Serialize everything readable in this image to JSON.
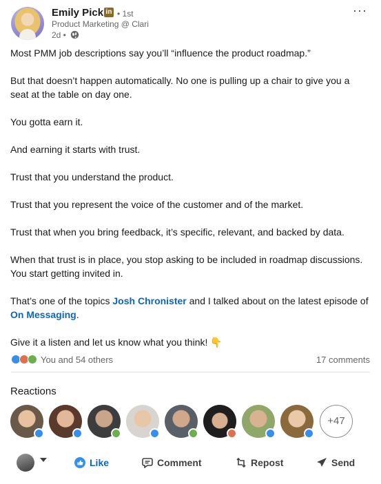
{
  "post": {
    "author": {
      "name": "Emily Pick",
      "connection_degree": "• 1st",
      "headline": "Product Marketing @ Clari",
      "time": "2d •"
    },
    "paragraphs": [
      "Most PMM job descriptions say you’ll “influence the product roadmap.”",
      "But that doesn’t happen automatically. No one is pulling up a chair to give you a seat at the table on day one.",
      "You gotta earn it.",
      "And earning it starts with trust.",
      "Trust that you understand the product.",
      "Trust that you represent the voice of the customer and of the market.",
      "Trust that when you bring feedback, it’s specific, relevant, and backed by data.",
      "When that trust is in place, you stop asking to be included in roadmap discussions. You start getting invited in."
    ],
    "mention_paragraph": {
      "before": "That’s one of the topics ",
      "mention1": "Josh Chronister",
      "middle": " and I talked about on the latest episode of ",
      "mention2": "On Messaging",
      "after": "."
    },
    "closing": "Give it a listen and let us know what you think! 👇"
  },
  "social": {
    "reactors_text": "You and 54 others",
    "comments_text": "17 comments"
  },
  "reactions": {
    "title": "Reactions",
    "more_count": "+47",
    "avatars": [
      {
        "type": "like",
        "color": "#c9a07a"
      },
      {
        "type": "like",
        "color": "#b07a58"
      },
      {
        "type": "support",
        "color": "#8a6d5a"
      },
      {
        "type": "like",
        "color": "#d4b08e"
      },
      {
        "type": "support",
        "color": "#7d6656"
      },
      {
        "type": "love",
        "color": "#4a4a4a"
      },
      {
        "type": "like",
        "color": "#9fb06a"
      },
      {
        "type": "like",
        "color": "#c4a584"
      }
    ]
  },
  "actions": {
    "like": "Like",
    "comment": "Comment",
    "repost": "Repost",
    "send": "Send"
  },
  "icons": [
    "globe-icon",
    "more-icon",
    "like-icon",
    "comment-icon",
    "repost-icon",
    "send-icon"
  ],
  "colors": {
    "link": "#0a66c2",
    "like": "#378fe9",
    "love": "#df704d",
    "support": "#6dae4f"
  }
}
